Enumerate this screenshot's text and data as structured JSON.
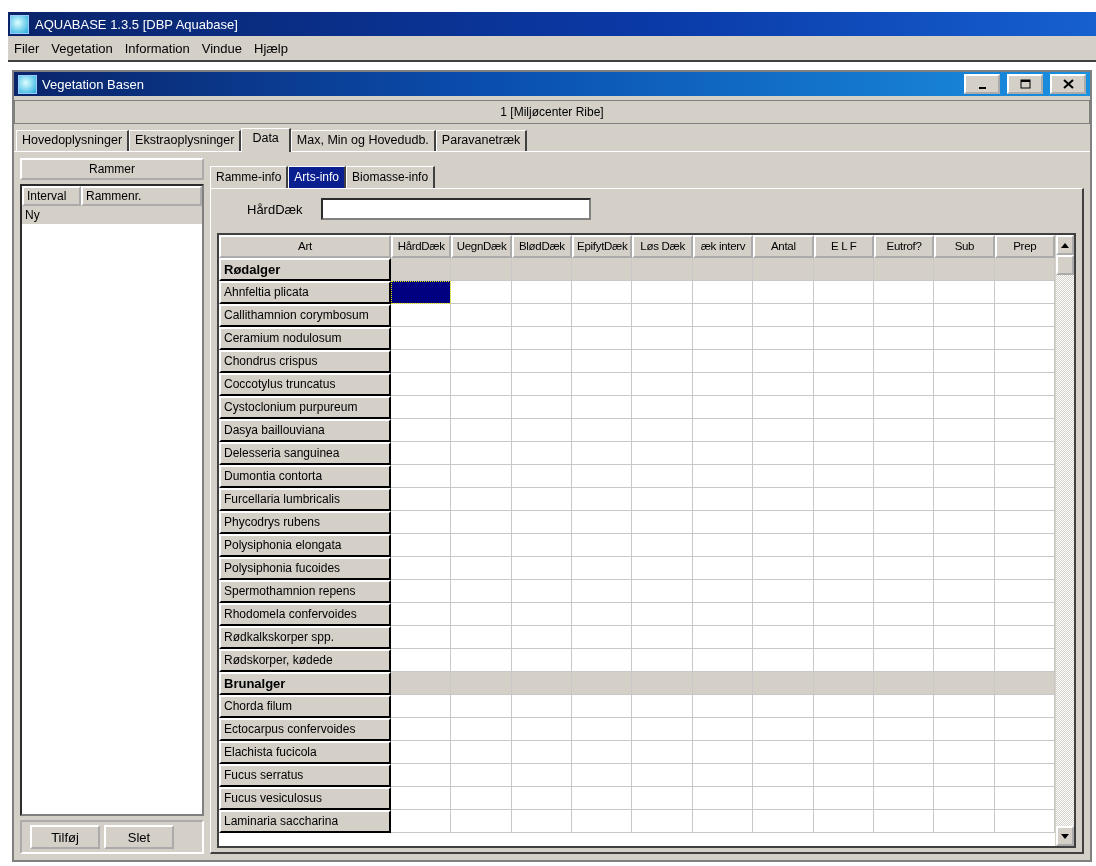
{
  "app_window": {
    "title": "AQUABASE 1.3.5 [DBP Aquabase]"
  },
  "menu": [
    "Filer",
    "Vegetation",
    "Information",
    "Vindue",
    "Hjælp"
  ],
  "child_window": {
    "title": "Vegetation Basen",
    "info": "1   [Miljøcenter Ribe]"
  },
  "tabs": [
    {
      "label": "Hovedoplysninger",
      "selected": false
    },
    {
      "label": "Ekstraoplysninger",
      "selected": false
    },
    {
      "label": "Data",
      "selected": true
    },
    {
      "label": "Max, Min og Hovedudb.",
      "selected": false
    },
    {
      "label": "Paravanetræk",
      "selected": false
    }
  ],
  "frames_panel": {
    "title": "Rammer",
    "columns": [
      "Interval",
      "Rammenr."
    ],
    "rows": [
      {
        "label": "Ny",
        "selected": true
      }
    ],
    "buttons": [
      "Tilføj",
      "Slet"
    ]
  },
  "sub_tabs": [
    {
      "label": "Ramme-info",
      "selected": false
    },
    {
      "label": "Arts-info",
      "selected": true
    },
    {
      "label": "Biomasse-info",
      "selected": false
    }
  ],
  "field": {
    "label": "HårdDæk"
  },
  "grid": {
    "columns": [
      "Art",
      "HårdDæk",
      "UegnDæk",
      "BlødDæk",
      "EpifytDæk",
      "Løs Dæk",
      "æk interv",
      "Antal",
      "E L F",
      "Eutrof?",
      "Sub",
      "Prep"
    ],
    "rows": [
      {
        "kind": "group",
        "name": "Rødalger",
        "selected": false
      },
      {
        "kind": "species",
        "name": "Ahnfeltia plicata",
        "selected": true
      },
      {
        "kind": "species",
        "name": "Callithamnion corymbosum",
        "selected": false
      },
      {
        "kind": "species",
        "name": "Ceramium nodulosum",
        "selected": false
      },
      {
        "kind": "species",
        "name": "Chondrus crispus",
        "selected": false
      },
      {
        "kind": "species",
        "name": "Coccotylus truncatus",
        "selected": false
      },
      {
        "kind": "species",
        "name": "Cystoclonium purpureum",
        "selected": false
      },
      {
        "kind": "species",
        "name": "Dasya baillouviana",
        "selected": false
      },
      {
        "kind": "species",
        "name": "Delesseria sanguinea",
        "selected": false
      },
      {
        "kind": "species",
        "name": "Dumontia contorta",
        "selected": false
      },
      {
        "kind": "species",
        "name": "Furcellaria lumbricalis",
        "selected": false
      },
      {
        "kind": "species",
        "name": "Phycodrys rubens",
        "selected": false
      },
      {
        "kind": "species",
        "name": "Polysiphonia elongata",
        "selected": false
      },
      {
        "kind": "species",
        "name": "Polysiphonia fucoides",
        "selected": false
      },
      {
        "kind": "species",
        "name": "Spermothamnion repens",
        "selected": false
      },
      {
        "kind": "species",
        "name": "Rhodomela confervoides",
        "selected": false
      },
      {
        "kind": "species",
        "name": "Rødkalkskorper spp.",
        "selected": false
      },
      {
        "kind": "species",
        "name": "Rødskorper, kødede",
        "selected": false
      },
      {
        "kind": "group",
        "name": "Brunalger",
        "selected": false
      },
      {
        "kind": "species",
        "name": "Chorda filum",
        "selected": false
      },
      {
        "kind": "species",
        "name": "Ectocarpus confervoides",
        "selected": false
      },
      {
        "kind": "species",
        "name": "Elachista fucicola",
        "selected": false
      },
      {
        "kind": "species",
        "name": "Fucus serratus",
        "selected": false
      },
      {
        "kind": "species",
        "name": "Fucus vesiculosus",
        "selected": false
      },
      {
        "kind": "species",
        "name": "Laminaria saccharina",
        "selected": false
      }
    ]
  }
}
